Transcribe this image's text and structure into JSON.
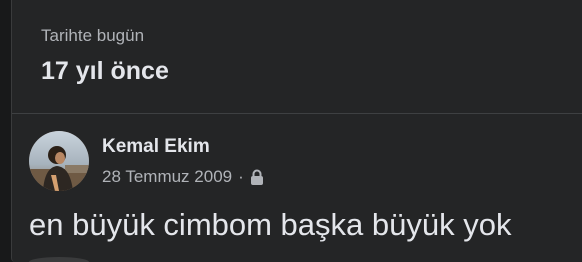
{
  "memory": {
    "subtitle": "Tarihte bugün",
    "title": "17 yıl önce"
  },
  "post": {
    "author": "Kemal Ekim",
    "date": "28 Temmuz 2009",
    "separator": "·",
    "privacy_icon": "lock-icon",
    "text": "en büyük cimbom başka büyük yok"
  },
  "colors": {
    "background": "#18191a",
    "card": "#242526",
    "primary_text": "#e4e6eb",
    "secondary_text": "#b0b3b8"
  }
}
